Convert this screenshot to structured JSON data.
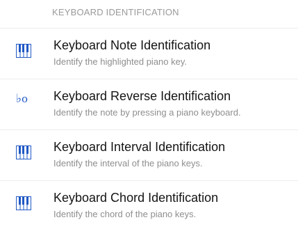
{
  "section": {
    "header": "KEYBOARD IDENTIFICATION"
  },
  "colors": {
    "accent": "#1f58c5"
  },
  "items": [
    {
      "icon": "piano-keyboard-icon",
      "title": "Keyboard Note Identification",
      "subtitle": "Identify the highlighted piano key."
    },
    {
      "icon": "flat-note-icon",
      "title": "Keyboard Reverse Identification",
      "subtitle": "Identify the note by pressing a piano keyboard."
    },
    {
      "icon": "piano-keyboard-icon",
      "title": "Keyboard Interval Identification",
      "subtitle": "Identify the interval of the piano keys."
    },
    {
      "icon": "piano-keyboard-icon",
      "title": "Keyboard Chord Identification",
      "subtitle": "Identify the chord of the piano keys."
    }
  ]
}
